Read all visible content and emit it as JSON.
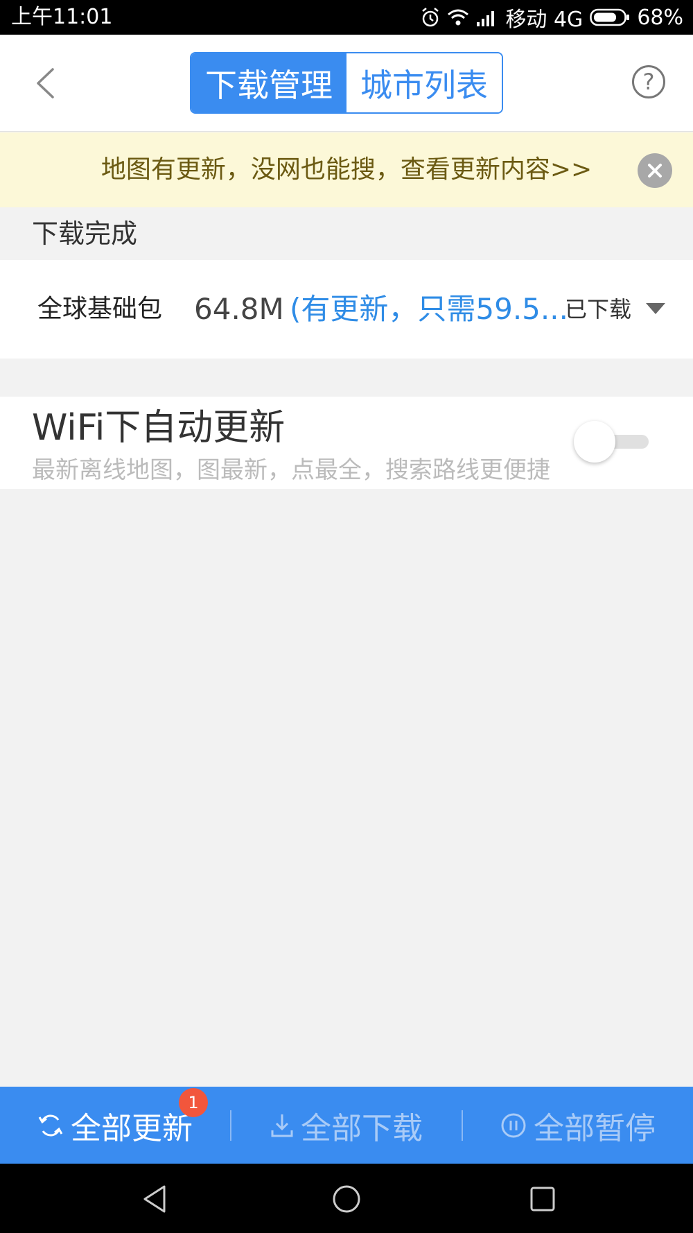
{
  "status_bar": {
    "time": "上午11:01",
    "carrier": "移动 4G",
    "battery": "68%",
    "icons": [
      "alarm-icon",
      "wifi-icon",
      "signal-icon",
      "battery-icon"
    ]
  },
  "header": {
    "tabs": [
      {
        "label": "下载管理",
        "active": true
      },
      {
        "label": "城市列表",
        "active": false
      }
    ],
    "help_symbol": "?"
  },
  "notice": {
    "text": "地图有更新，没网也能搜，查看更新内容>>"
  },
  "downloaded": {
    "section_title": "下载完成",
    "items": [
      {
        "name": "全球基础包",
        "size": "64.8M",
        "update_note": "(有更新，只需59.5...",
        "status": "已下载"
      }
    ]
  },
  "wifi_auto_update": {
    "title": "WiFi下自动更新",
    "description": "最新离线地图，图最新，点最全，搜索路线更便捷",
    "enabled": false
  },
  "action_bar": {
    "update_all": "全部更新",
    "update_badge": "1",
    "download_all": "全部下载",
    "pause_all": "全部暂停"
  },
  "colors": {
    "accent": "#3a8cf0",
    "notice_bg": "#fcf8d8",
    "badge": "#f2563c"
  }
}
